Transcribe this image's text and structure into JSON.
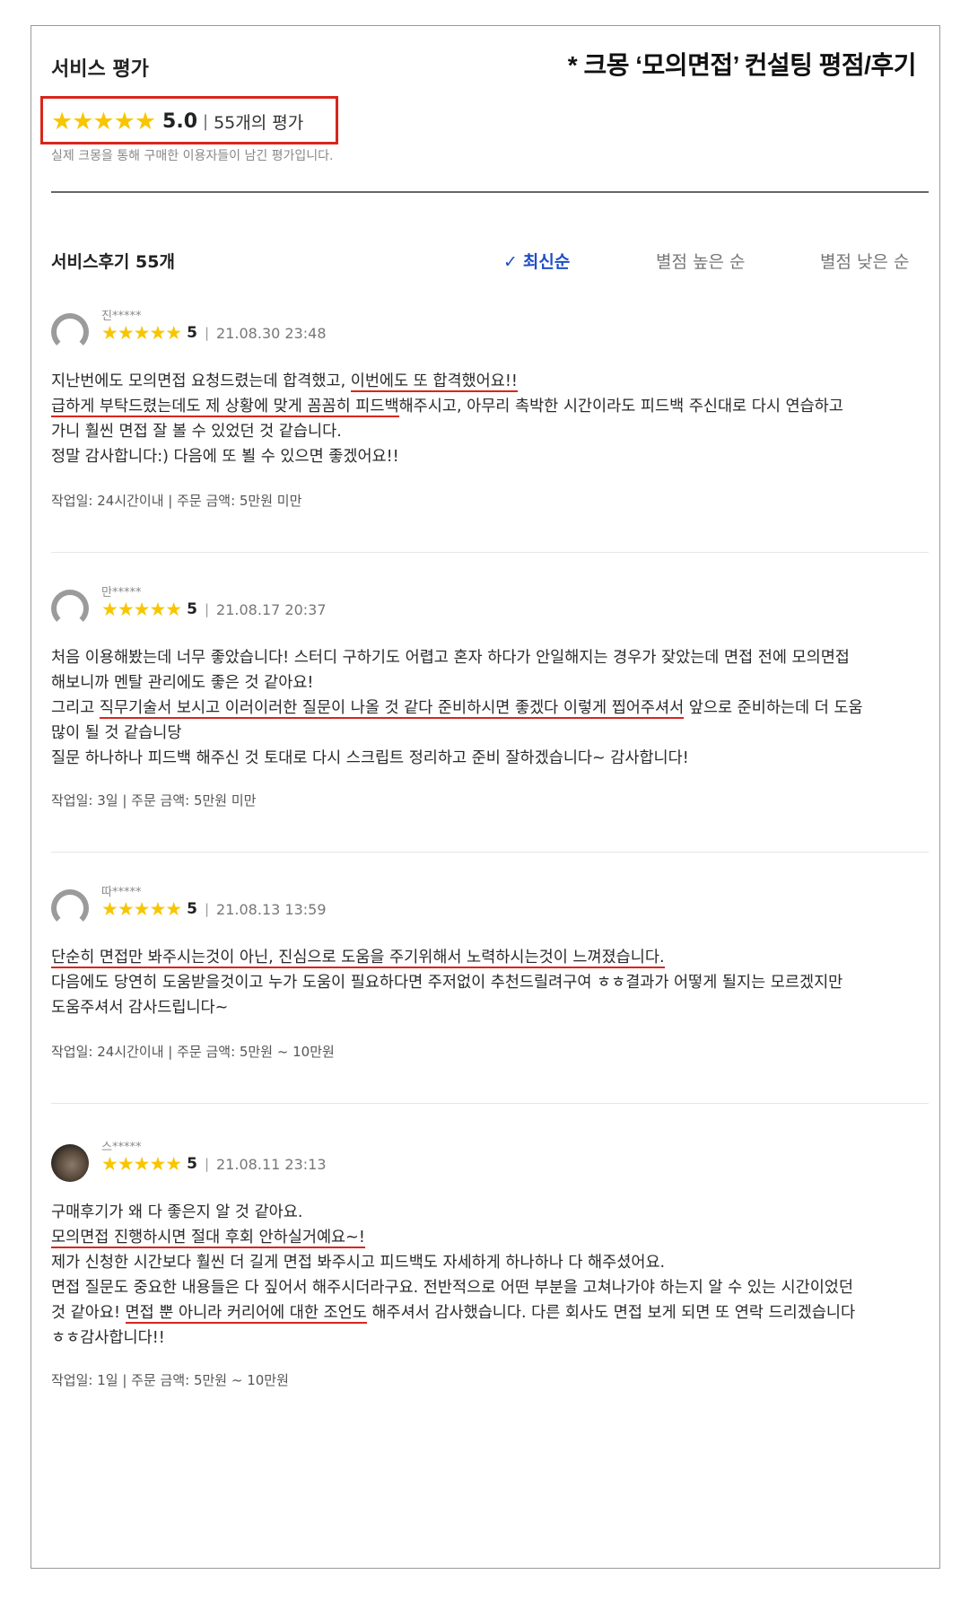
{
  "service": {
    "title": "서비스 평가",
    "caption": "* 크몽 ‘모의면접’ 컨설팅 평점/후기",
    "stars": "★★★★★",
    "score": "5.0",
    "separator": "|",
    "count_label": "55개의 평가",
    "note": "실제 크몽을 통해 구매한 이용자들이 남긴 평가입니다."
  },
  "reviews_header": {
    "count_label": "서비스후기 55개",
    "sort_options": [
      {
        "label": "최신순",
        "active": true
      },
      {
        "label": "별점 높은 순",
        "active": false
      },
      {
        "label": "별점 낮은 순",
        "active": false
      }
    ],
    "check_icon": "✓"
  },
  "reviews": [
    {
      "username": "진*****",
      "stars": "★★★★★",
      "score": "5",
      "separator": "|",
      "date": "21.08.30 23:48",
      "lines": [
        [
          "지난번에도 모의면접 요청드렸는데 합격했고, ",
          "이번에도 또 합격했어요!!",
          ""
        ],
        [
          "",
          "급하게 부탁드렸는데도 제 상황에 맞게 꼼꼼히 피드백",
          "해주시고, 아무리 촉박한 시간이라도 피드백 주신대로 다시 연습하고"
        ],
        [
          "가니 훨씬 면접 잘 볼 수 있었던 것 같습니다.",
          "",
          ""
        ],
        [
          "정말 감사합니다:) 다음에 또 뵐 수 있으면 좋겠어요!!",
          "",
          ""
        ]
      ],
      "meta": "작업일: 24시간이내 | 주문 금액: 5만원 미만"
    },
    {
      "username": "만*****",
      "stars": "★★★★★",
      "score": "5",
      "separator": "|",
      "date": "21.08.17 20:37",
      "lines": [
        [
          "처음 이용해봤는데 너무 좋았습니다! 스터디 구하기도 어렵고 혼자 하다가 안일해지는 경우가 잦았는데 면접 전에 모의면접",
          "",
          ""
        ],
        [
          "해보니까 멘탈 관리에도 좋은 것 같아요!",
          "",
          ""
        ],
        [
          "그리고 ",
          "직무기술서 보시고 이러이러한 질문이 나올 것 같다 준비하시면 좋겠다 이렇게 찝어주셔서",
          " 앞으로 준비하는데 더 도움"
        ],
        [
          "많이 될 것 같습니당",
          "",
          ""
        ],
        [
          "질문 하나하나 피드백 해주신 것 토대로 다시 스크립트 정리하고 준비 잘하겠습니다~ 감사합니다!",
          "",
          ""
        ]
      ],
      "meta": "작업일: 3일 | 주문 금액: 5만원 미만"
    },
    {
      "username": "따*****",
      "stars": "★★★★★",
      "score": "5",
      "separator": "|",
      "date": "21.08.13 13:59",
      "lines": [
        [
          "",
          "단순히 면접만 봐주시는것이 아닌, 진심으로 도움을 주기위해서 노력하시는것이 느껴졌습니다.",
          ""
        ],
        [
          "다음에도 당연히 도움받을것이고 누가 도움이 필요하다면 주저없이 추천드릴려구여 ㅎㅎ결과가 어떻게 될지는 모르겠지만",
          "",
          ""
        ],
        [
          "도움주셔서 감사드립니다~",
          "",
          ""
        ]
      ],
      "meta": "작업일: 24시간이내 | 주문 금액: 5만원 ~ 10만원"
    },
    {
      "username": "스*****",
      "stars": "★★★★★",
      "score": "5",
      "separator": "|",
      "date": "21.08.11 23:13",
      "lines": [
        [
          "구매후기가 왜 다 좋은지 알 것 같아요.",
          "",
          ""
        ],
        [
          "",
          "모의면접 진행하시면 절대 후회 안하실거예요~!",
          ""
        ],
        [
          "제가 신청한 시간보다 훨씬 더 길게 면접 봐주시고 피드백도 자세하게 하나하나 다 해주셨어요.",
          "",
          ""
        ],
        [
          "면접 질문도 중요한 내용들은 다 짚어서 해주시더라구요. 전반적으로 어떤 부분을 고쳐나가야 하는지 알 수 있는 시간이었던",
          "",
          ""
        ],
        [
          "것 같아요!  ",
          "면접 뿐 아니라 커리어에 대한 조언도",
          " 해주셔서 감사했습니다. 다른 회사도 면접 보게 되면 또 연락 드리겠습니다"
        ],
        [
          "ㅎㅎ감사합니다!!",
          "",
          ""
        ]
      ],
      "meta": "작업일: 1일 | 주문 금액: 5만원 ~ 10만원"
    }
  ],
  "colors": {
    "star": "#f7c600",
    "highlight": "#d8261c",
    "active_sort": "#1f4fc4"
  }
}
